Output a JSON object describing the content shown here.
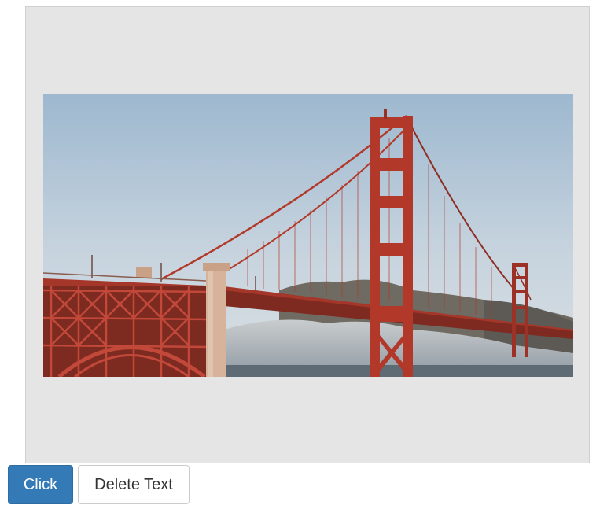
{
  "image": {
    "subject": "golden-gate-bridge"
  },
  "buttons": {
    "click_label": "Click",
    "delete_label": "Delete Text"
  },
  "colors": {
    "primary": "#337ab7",
    "frame_bg": "#e5e5e5",
    "bridge": "#b2392a"
  }
}
